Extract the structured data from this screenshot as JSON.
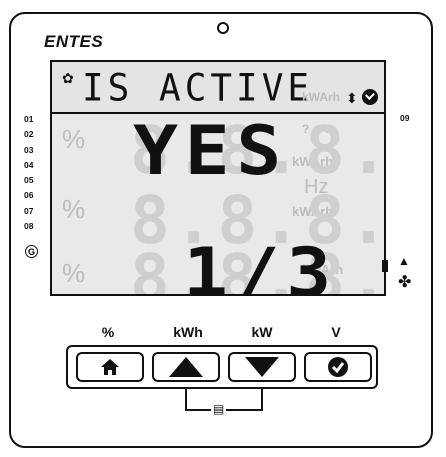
{
  "brand": "ENTES",
  "display": {
    "status_text": "IS ACTIVE",
    "value_row1": "YES",
    "value_row3": "1/3",
    "ghost_unit_top": "kWArh",
    "ghost_unit_mid": "Hz",
    "ghost_unit_mid2": "kWArh",
    "ghost_unit_bottom": "kWArh"
  },
  "side_labels": [
    "01",
    "02",
    "03",
    "04",
    "05",
    "06",
    "07",
    "08"
  ],
  "right_label": "09",
  "ground_label": "G",
  "buttons": {
    "labels": [
      "%",
      "kWh",
      "kW",
      "V"
    ],
    "items": [
      {
        "name": "home-button",
        "icon": "home-icon"
      },
      {
        "name": "up-button",
        "icon": "triangle-up-icon"
      },
      {
        "name": "down-button",
        "icon": "triangle-down-icon"
      },
      {
        "name": "ok-button",
        "icon": "check-circle-icon"
      }
    ]
  },
  "colors": {
    "lcd_bg": "#e9e9e9",
    "ink": "#111111",
    "ghost": "#cfcfcf"
  }
}
